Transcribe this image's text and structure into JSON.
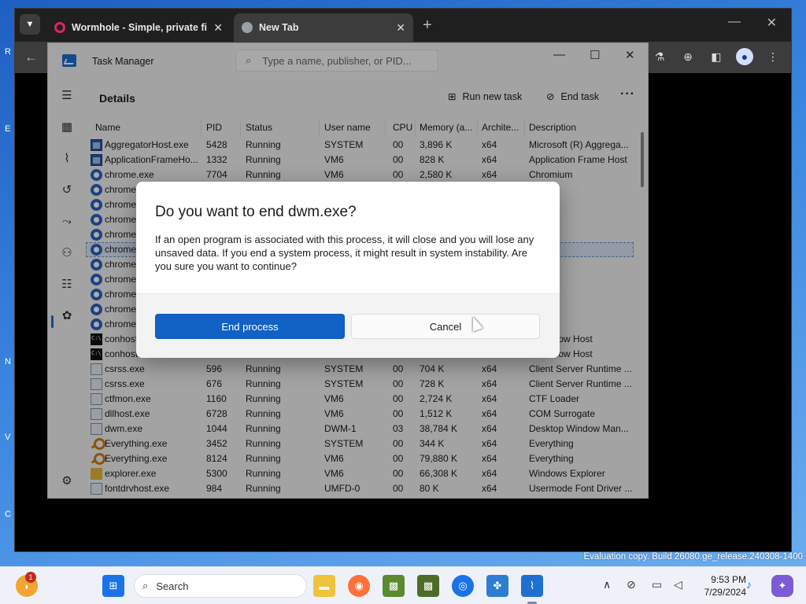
{
  "browser": {
    "tabs": [
      {
        "label": "Wormhole - Simple, private file",
        "close": "✕"
      },
      {
        "label": "New Tab",
        "close": "✕"
      }
    ],
    "new_tab": "+",
    "window_controls": {
      "minimize": "—",
      "maximize": "☐",
      "close": "✕"
    },
    "back": "←"
  },
  "task_manager": {
    "title": "Task Manager",
    "search_placeholder": "Type a name, publisher, or PID...",
    "window_controls": {
      "minimize": "—",
      "maximize": "☐",
      "close": "✕"
    },
    "section_title": "Details",
    "actions": {
      "run_new_task": "Run new task",
      "end_task": "End task",
      "more": "···"
    },
    "columns": [
      "Name",
      "PID",
      "Status",
      "User name",
      "CPU",
      "Memory (a...",
      "Archite...",
      "Description"
    ],
    "rows": [
      {
        "icon": "app",
        "name": "AggregatorHost.exe",
        "pid": "5428",
        "status": "Running",
        "user": "SYSTEM",
        "cpu": "00",
        "mem": "3,896 K",
        "arch": "x64",
        "desc": "Microsoft (R) Aggrega..."
      },
      {
        "icon": "app",
        "name": "ApplicationFrameHo...",
        "pid": "1332",
        "status": "Running",
        "user": "VM6",
        "cpu": "00",
        "mem": "828 K",
        "arch": "x64",
        "desc": "Application Frame Host"
      },
      {
        "icon": "chrome",
        "name": "chrome.exe",
        "pid": "7704",
        "status": "Running",
        "user": "VM6",
        "cpu": "00",
        "mem": "2,580 K",
        "arch": "x64",
        "desc": "Chromium"
      },
      {
        "icon": "chrome",
        "name": "chrome",
        "pid": "",
        "status": "",
        "user": "",
        "cpu": "",
        "mem": "",
        "arch": "",
        "desc": "um"
      },
      {
        "icon": "chrome",
        "name": "chrome",
        "pid": "",
        "status": "",
        "user": "",
        "cpu": "",
        "mem": "",
        "arch": "",
        "desc": "um"
      },
      {
        "icon": "chrome",
        "name": "chrome",
        "pid": "",
        "status": "",
        "user": "",
        "cpu": "",
        "mem": "",
        "arch": "",
        "desc": "um"
      },
      {
        "icon": "chrome",
        "name": "chrome",
        "pid": "",
        "status": "",
        "user": "",
        "cpu": "",
        "mem": "",
        "arch": "",
        "desc": "um"
      },
      {
        "icon": "chrome",
        "name": "chrome",
        "pid": "",
        "status": "",
        "user": "",
        "cpu": "",
        "mem": "",
        "arch": "",
        "desc": "um",
        "selected": true
      },
      {
        "icon": "chrome",
        "name": "chrome",
        "pid": "",
        "status": "",
        "user": "",
        "cpu": "",
        "mem": "",
        "arch": "",
        "desc": "um"
      },
      {
        "icon": "chrome",
        "name": "chrome",
        "pid": "",
        "status": "",
        "user": "",
        "cpu": "",
        "mem": "",
        "arch": "",
        "desc": "um"
      },
      {
        "icon": "chrome",
        "name": "chrome",
        "pid": "",
        "status": "",
        "user": "",
        "cpu": "",
        "mem": "",
        "arch": "",
        "desc": "um"
      },
      {
        "icon": "chrome",
        "name": "chrome",
        "pid": "",
        "status": "",
        "user": "",
        "cpu": "",
        "mem": "",
        "arch": "",
        "desc": "um"
      },
      {
        "icon": "chrome",
        "name": "chrome",
        "pid": "",
        "status": "",
        "user": "",
        "cpu": "",
        "mem": "",
        "arch": "",
        "desc": "um"
      },
      {
        "icon": "console",
        "name": "conhost",
        "pid": "",
        "status": "",
        "user": "",
        "cpu": "",
        "mem": "",
        "arch": "",
        "desc": "e Window Host"
      },
      {
        "icon": "console",
        "name": "conhost",
        "pid": "",
        "status": "",
        "user": "",
        "cpu": "",
        "mem": "",
        "arch": "",
        "desc": "e Window Host"
      },
      {
        "icon": "generic",
        "name": "csrss.exe",
        "pid": "596",
        "status": "Running",
        "user": "SYSTEM",
        "cpu": "00",
        "mem": "704 K",
        "arch": "x64",
        "desc": "Client Server Runtime ..."
      },
      {
        "icon": "generic",
        "name": "csrss.exe",
        "pid": "676",
        "status": "Running",
        "user": "SYSTEM",
        "cpu": "00",
        "mem": "728 K",
        "arch": "x64",
        "desc": "Client Server Runtime ..."
      },
      {
        "icon": "generic",
        "name": "ctfmon.exe",
        "pid": "1160",
        "status": "Running",
        "user": "VM6",
        "cpu": "00",
        "mem": "2,724 K",
        "arch": "x64",
        "desc": "CTF Loader"
      },
      {
        "icon": "generic",
        "name": "dllhost.exe",
        "pid": "6728",
        "status": "Running",
        "user": "VM6",
        "cpu": "00",
        "mem": "1,512 K",
        "arch": "x64",
        "desc": "COM Surrogate"
      },
      {
        "icon": "generic",
        "name": "dwm.exe",
        "pid": "1044",
        "status": "Running",
        "user": "DWM-1",
        "cpu": "03",
        "mem": "38,784 K",
        "arch": "x64",
        "desc": "Desktop Window Man..."
      },
      {
        "icon": "search",
        "name": "Everything.exe",
        "pid": "3452",
        "status": "Running",
        "user": "SYSTEM",
        "cpu": "00",
        "mem": "344 K",
        "arch": "x64",
        "desc": "Everything"
      },
      {
        "icon": "search",
        "name": "Everything.exe",
        "pid": "8124",
        "status": "Running",
        "user": "VM6",
        "cpu": "00",
        "mem": "79,880 K",
        "arch": "x64",
        "desc": "Everything"
      },
      {
        "icon": "folder",
        "name": "explorer.exe",
        "pid": "5300",
        "status": "Running",
        "user": "VM6",
        "cpu": "00",
        "mem": "66,308 K",
        "arch": "x64",
        "desc": "Windows Explorer"
      },
      {
        "icon": "generic",
        "name": "fontdrvhost.exe",
        "pid": "984",
        "status": "Running",
        "user": "UMFD-0",
        "cpu": "00",
        "mem": "80 K",
        "arch": "x64",
        "desc": "Usermode Font Driver ..."
      }
    ]
  },
  "dialog": {
    "title": "Do you want to end dwm.exe?",
    "body": "If an open program is associated with this process, it will close and you will lose any unsaved data. If you end a system process, it might result in system instability. Are you sure you want to continue?",
    "primary": "End process",
    "secondary": "Cancel"
  },
  "desktop": {
    "watermark": "Evaluation copy. Build 26080.ge_release.240308-1400"
  },
  "taskbar": {
    "badge": "1",
    "search_label": "Search",
    "time": "9:53 PM",
    "date": "7/29/2024"
  }
}
